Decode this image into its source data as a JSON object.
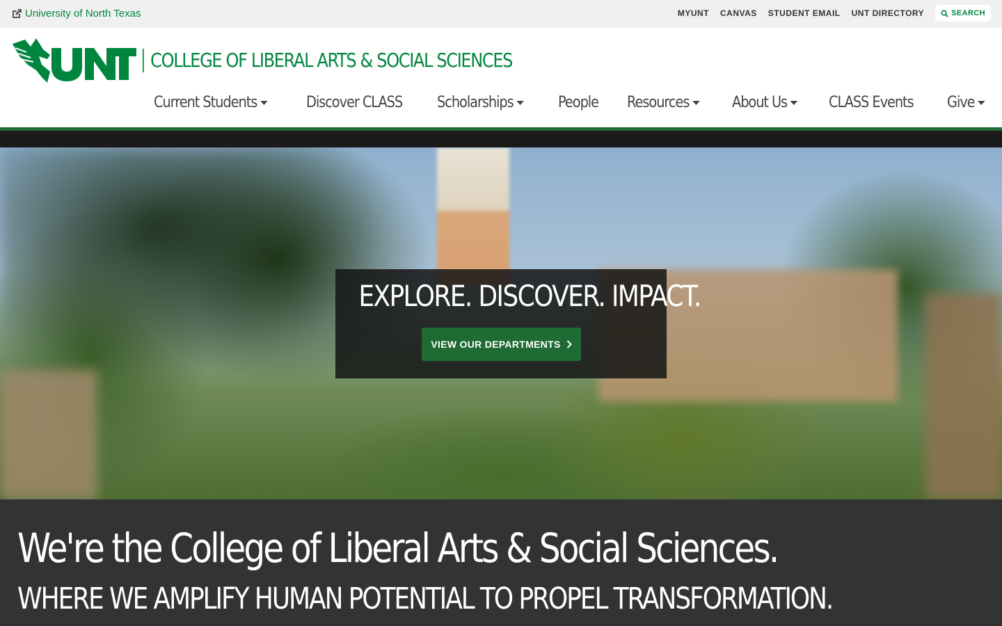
{
  "utility": {
    "home_link": "University of North Texas",
    "links": [
      "MYUNT",
      "CANVAS",
      "STUDENT EMAIL",
      "UNT DIRECTORY"
    ],
    "search_label": "SEARCH"
  },
  "header": {
    "logo_text": "UNT",
    "college_name": "COLLEGE OF LIBERAL ARTS & SOCIAL SCIENCES",
    "nav": [
      {
        "label": "Current Students",
        "dropdown": true
      },
      {
        "label": "Discover CLASS",
        "dropdown": false
      },
      {
        "label": "Scholarships",
        "dropdown": true
      },
      {
        "label": "People",
        "dropdown": false
      },
      {
        "label": "Resources",
        "dropdown": true
      },
      {
        "label": "About Us",
        "dropdown": true
      },
      {
        "label": "CLASS Events",
        "dropdown": false
      },
      {
        "label": "Give",
        "dropdown": true
      }
    ]
  },
  "hero": {
    "headline": "EXPLORE. DISCOVER. IMPACT.",
    "cta_label": "VIEW OUR DEPARTMENTS"
  },
  "intro": {
    "heading": "We're the College of Liberal Arts & Social Sciences.",
    "subheading": "WHERE WE AMPLIFY HUMAN POTENTIAL TO PROPEL TRANSFORMATION."
  },
  "colors": {
    "unt_green": "#00853e",
    "dark_green": "#1f6b34",
    "intro_bg": "#333333"
  }
}
